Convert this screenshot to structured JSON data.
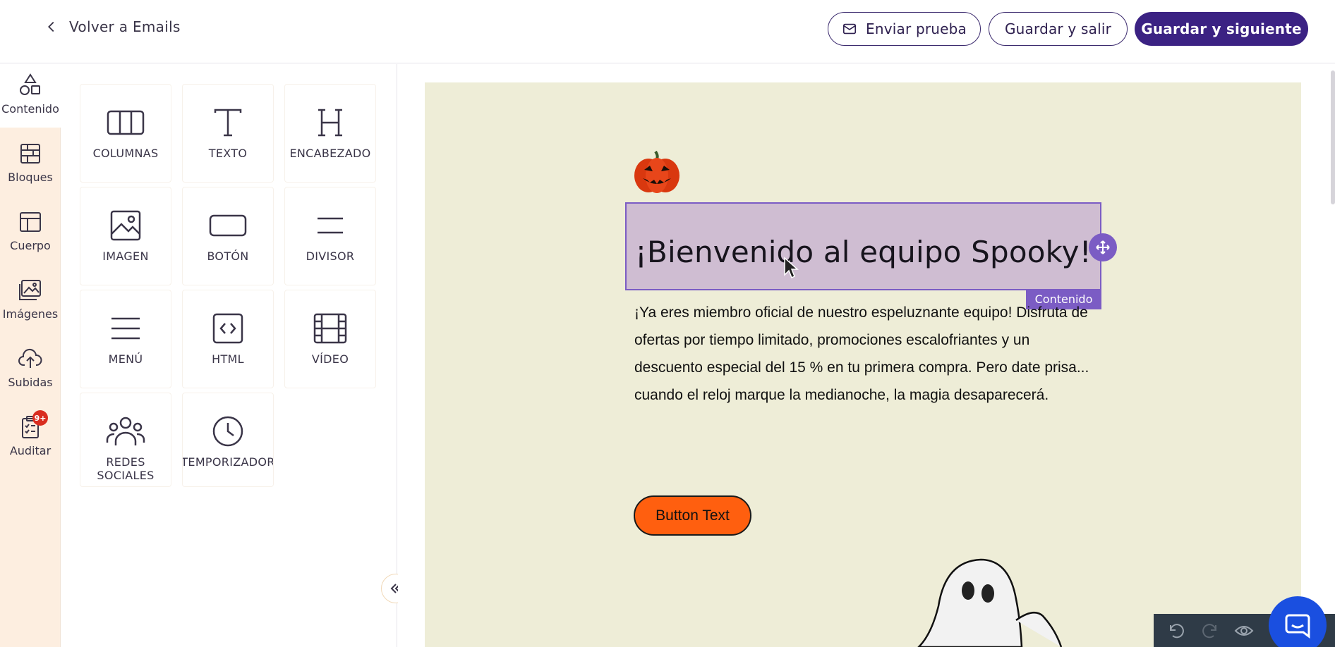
{
  "header": {
    "back_label": "Volver a Emails",
    "send_test_label": "Enviar prueba",
    "save_exit_label": "Guardar y salir",
    "save_next_label": "Guardar y siguiente"
  },
  "rail": {
    "items": [
      {
        "label": "Contenido",
        "icon": "shapes-icon",
        "active": true
      },
      {
        "label": "Bloques",
        "icon": "bricks-icon"
      },
      {
        "label": "Cuerpo",
        "icon": "layout-icon"
      },
      {
        "label": "Imágenes",
        "icon": "images-icon"
      },
      {
        "label": "Subidas",
        "icon": "cloud-upload-icon"
      },
      {
        "label": "Auditar",
        "icon": "clipboard-check-icon",
        "badge": "9+"
      }
    ]
  },
  "tools": [
    {
      "label": "COLUMNAS",
      "icon": "columns-icon"
    },
    {
      "label": "TEXTO",
      "icon": "text-icon"
    },
    {
      "label": "ENCABEZADO",
      "icon": "heading-icon"
    },
    {
      "label": "IMAGEN",
      "icon": "image-icon"
    },
    {
      "label": "BOTÓN",
      "icon": "button-icon"
    },
    {
      "label": "DIVISOR",
      "icon": "divider-icon"
    },
    {
      "label": "MENÚ",
      "icon": "menu-icon"
    },
    {
      "label": "HTML",
      "icon": "code-icon"
    },
    {
      "label": "VÍDEO",
      "icon": "video-icon"
    },
    {
      "label": "REDES SOCIALES",
      "icon": "social-icon"
    },
    {
      "label": "TEMPORIZADOR",
      "icon": "clock-icon"
    }
  ],
  "email": {
    "heading": "¡Bienvenido al equipo Spooky!",
    "selection_tag": "Contenido",
    "body": "¡Ya eres miembro oficial de nuestro espeluznante equipo! Disfruta de ofertas por tiempo limitado, promociones escalofriantes y un descuento especial del 15 % en tu primera compra. Pero date prisa... cuando el reloj marque la medianoche, la magia desaparecerá.",
    "button_label": "Button Text"
  },
  "colors": {
    "primary": "#3b2283",
    "selection": "#7b5cc4",
    "email_bg": "#eeedd7",
    "cta": "#ff5f0f",
    "rail_bg": "#fdeee0"
  }
}
